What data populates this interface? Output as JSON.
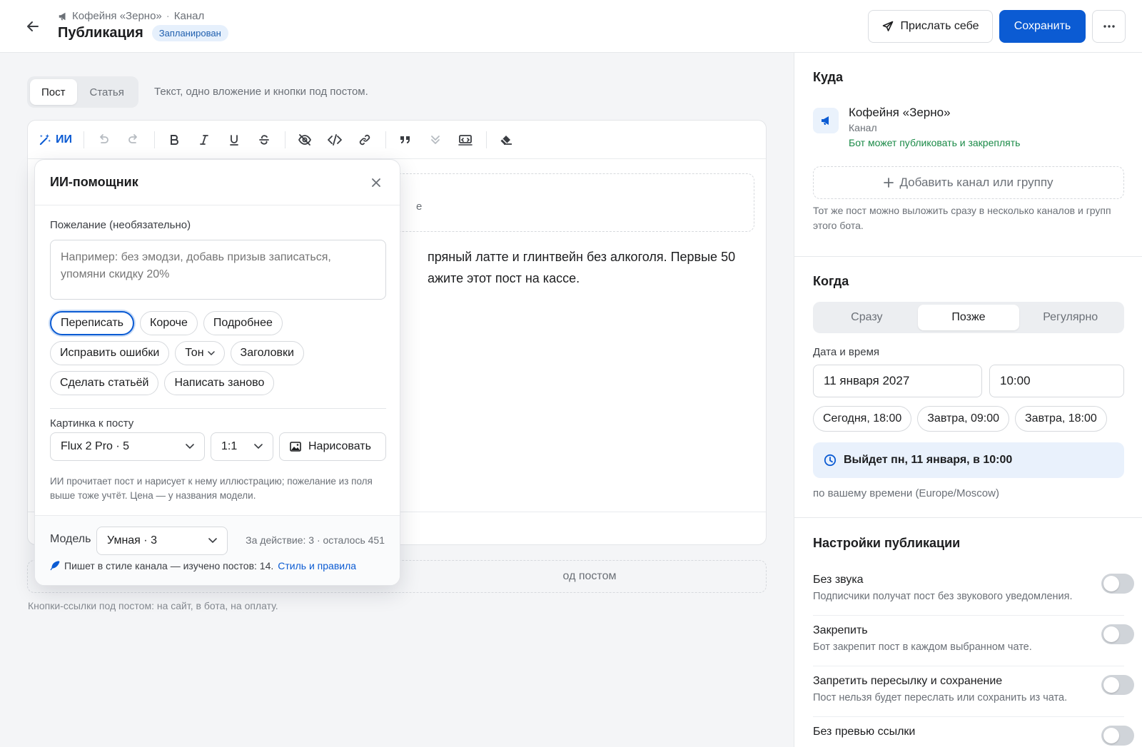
{
  "header": {
    "breadcrumb_channel": "Кофейня «Зерно»",
    "breadcrumb_sep": "·",
    "breadcrumb_type": "Канал",
    "title": "Публикация",
    "status": "Запланирован",
    "send_to_self": "Прислать себе",
    "save": "Сохранить"
  },
  "mode": {
    "tabs": [
      "Пост",
      "Статья"
    ],
    "active": "Пост",
    "hint": "Текст, одно вложение и кнопки под постом."
  },
  "toolbar": {
    "ai_label": "ИИ"
  },
  "editor": {
    "body_line1": "пряный латте и глинтвейн без алкоголя. Первые 50",
    "body_line2": "ажите этот пост на кассе.",
    "buttons_zone": "од постом",
    "buttons_hint": "Кнопки-ссылки под постом: на сайт, в бота, на оплату.",
    "attach_hint": "е"
  },
  "ai": {
    "title": "ИИ-помощник",
    "wish_label": "Пожелание (необязательно)",
    "wish_placeholder": "Например: без эмодзи, добавь призыв записаться, упомяни скидку 20%",
    "chips": [
      "Переписать",
      "Короче",
      "Подробнее",
      "Исправить ошибки",
      "Тон",
      "Заголовки",
      "Сделать статьёй",
      "Написать заново"
    ],
    "image_label": "Картинка к посту",
    "image_model": "Flux 2 Pro · 5",
    "aspect": "1:1",
    "draw": "Нарисовать",
    "image_note": "ИИ прочитает пост и нарисует к нему иллюстрацию; пожелание из поля выше тоже учтёт. Цена — у названия модели.",
    "model_label": "Модель",
    "model_value": "Умная · 3",
    "quota": "За действие: 3 · осталось 451",
    "style_note": "Пишет в стиле канала — изучено постов: 14.",
    "style_link": "Стиль и правила"
  },
  "side": {
    "where_title": "Куда",
    "channel_name": "Кофейня «Зерно»",
    "channel_type": "Канал",
    "channel_perm": "Бот может публиковать и закреплять",
    "add_channel": "Добавить канал или группу",
    "where_hint": "Тот же пост можно выложить сразу в несколько каналов и групп этого бота.",
    "when_title": "Когда",
    "when_options": [
      "Сразу",
      "Позже",
      "Регулярно"
    ],
    "when_active": "Позже",
    "datetime_label": "Дата и время",
    "date_value": "11 января 2027",
    "time_value": "10:00",
    "quick": [
      "Сегодня, 18:00",
      "Завтра, 09:00",
      "Завтра, 18:00"
    ],
    "publish_summary": "Выйдет пн, 11 января, в 10:00",
    "tz_note": "по вашему времени (Europe/Moscow)",
    "settings_title": "Настройки публикации",
    "options": [
      {
        "title": "Без звука",
        "desc": "Подписчики получат пост без звукового уведомления.",
        "on": false
      },
      {
        "title": "Закрепить",
        "desc": "Бот закрепит пост в каждом выбранном чате.",
        "on": false
      },
      {
        "title": "Запретить пересылку и сохранение",
        "desc": "Пост нельзя будет переслать или сохранить из чата.",
        "on": false
      },
      {
        "title": "Без превью ссылки",
        "desc": "",
        "on": false
      }
    ]
  },
  "colors": {
    "accent": "#0b5bd3",
    "success": "#1a8a47",
    "badge_bg": "#e6f0fc"
  }
}
